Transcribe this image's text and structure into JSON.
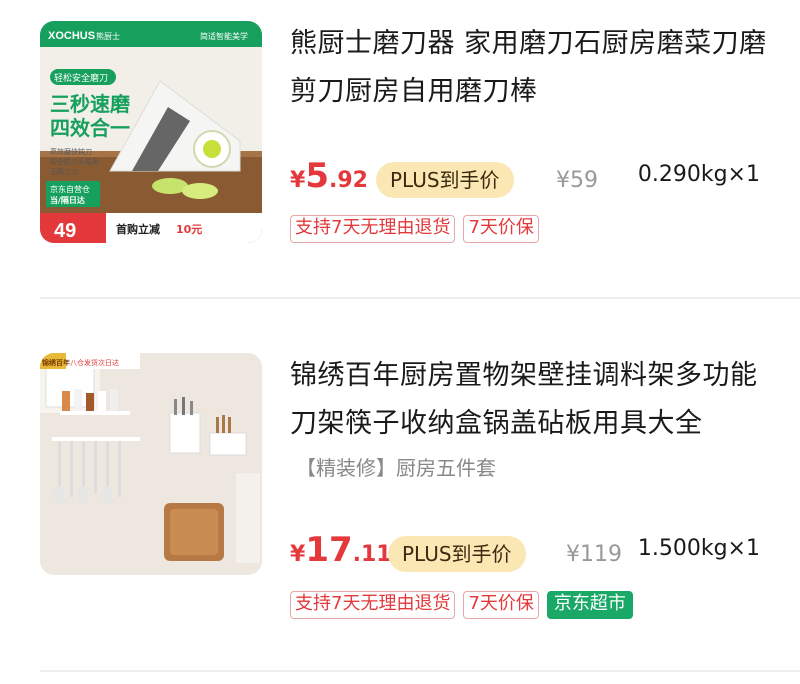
{
  "products": [
    {
      "title": "熊厨士磨刀器 家用磨刀石厨房磨菜刀磨剪刀厨房自用磨刀棒",
      "price_symbol": "¥",
      "price_integer": "5",
      "price_decimal": ".92",
      "plus_label": "PLUS到手价",
      "original_price": "¥59",
      "weight": "0.290kg×1",
      "tags": [
        "支持7天无理由退货",
        "7天价保"
      ],
      "image": {
        "brand": "XOCHUS",
        "brand_cn": "熊厨士",
        "slogan": "简适智能美学",
        "badge_top": "轻松安全磨刀",
        "headline_1": "三秒速磨",
        "headline_2": "四效合一",
        "features": [
          "高效磨快钝刀",
          "安全防刀手易用",
          "无损刀刃"
        ],
        "delivery_1": "京东自营仓",
        "delivery_2": "当/隔日达",
        "promo_price": "49",
        "promo_text": "首购立减",
        "promo_amount": "10元"
      }
    },
    {
      "title": "锦绣百年厨房置物架壁挂调料架多功能刀架筷子收纳盒锅盖砧板用具大全",
      "spec": "【精装修】厨房五件套",
      "price_symbol": "¥",
      "price_integer": "17",
      "price_decimal": ".11",
      "plus_label": "PLUS到手价",
      "original_price": "¥119",
      "weight": "1.500kg×1",
      "tags": [
        "支持7天无理由退货",
        "7天价保"
      ],
      "store_tag": "京东超市",
      "image": {
        "brand": "锦绣百年",
        "banner": "八仓发货次日达"
      }
    }
  ],
  "colors": {
    "price_red": "#e4393c",
    "plus_gold": "#fbe7b4",
    "store_green": "#1aa867",
    "brand_green": "#17a05d"
  }
}
